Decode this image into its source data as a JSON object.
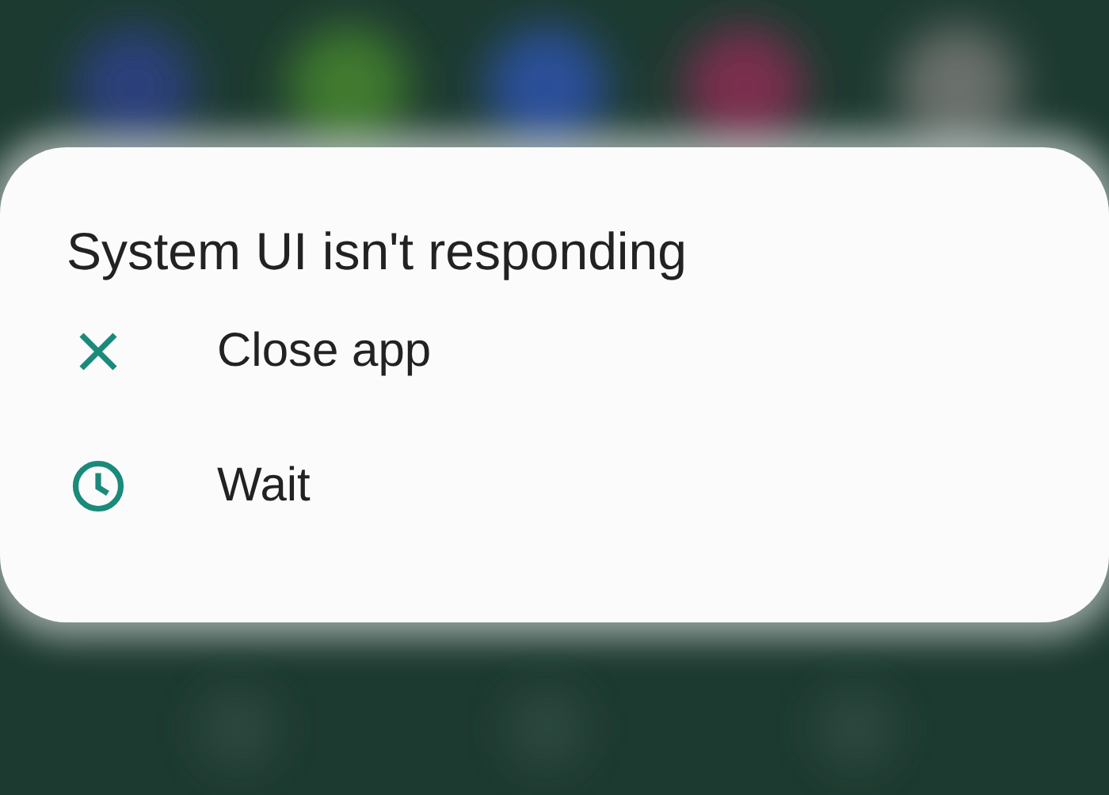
{
  "dialog": {
    "title": "System UI isn't responding",
    "options": [
      {
        "kind": "close",
        "label": "Close app"
      },
      {
        "kind": "wait",
        "label": "Wait"
      }
    ]
  }
}
